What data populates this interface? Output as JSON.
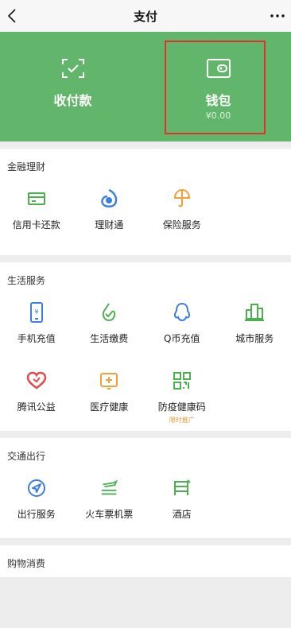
{
  "navbar": {
    "title": "支付"
  },
  "hero": {
    "items": [
      {
        "label": "收付款",
        "sub": ""
      },
      {
        "label": "钱包",
        "sub": "¥0.00"
      }
    ]
  },
  "sections": [
    {
      "title": "金融理财",
      "items": [
        {
          "label": "信用卡还款",
          "icon": "credit-card-icon",
          "color": "#4caf50"
        },
        {
          "label": "理财通",
          "icon": "wealth-icon",
          "color": "#3d7fe0"
        },
        {
          "label": "保险服务",
          "icon": "umbrella-icon",
          "color": "#f0a13a"
        }
      ]
    },
    {
      "title": "生活服务",
      "items": [
        {
          "label": "手机充值",
          "icon": "phone-icon",
          "color": "#3d7fe0"
        },
        {
          "label": "生活缴费",
          "icon": "check-drop-icon",
          "color": "#4caf50"
        },
        {
          "label": "Q币充值",
          "icon": "qq-icon",
          "color": "#3d7fe0"
        },
        {
          "label": "城市服务",
          "icon": "city-icon",
          "color": "#4caf50"
        },
        {
          "label": "腾讯公益",
          "icon": "heart-icon",
          "color": "#e04b4b"
        },
        {
          "label": "医疗健康",
          "icon": "medical-icon",
          "color": "#f0a13a"
        },
        {
          "label": "防疫健康码",
          "icon": "qr-code-icon",
          "color": "#4caf50",
          "tag": "限时推广"
        }
      ]
    },
    {
      "title": "交通出行",
      "items": [
        {
          "label": "出行服务",
          "icon": "navigation-icon",
          "color": "#3d7fe0"
        },
        {
          "label": "火车票机票",
          "icon": "train-plane-icon",
          "color": "#4caf50"
        },
        {
          "label": "酒店",
          "icon": "hotel-bed-icon",
          "color": "#4caf50"
        }
      ]
    },
    {
      "title": "购物消费",
      "items": []
    }
  ]
}
